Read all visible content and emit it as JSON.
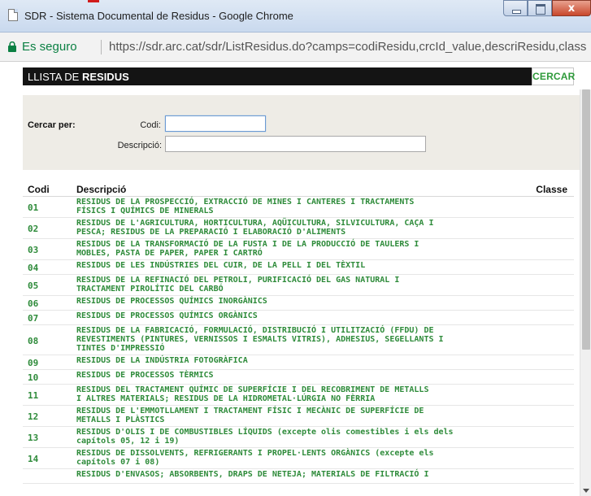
{
  "window": {
    "title": "SDR - Sistema Documental de Residus - Google Chrome"
  },
  "addressbar": {
    "secure_label": "Es seguro",
    "url": "https://sdr.arc.cat/sdr/ListResidus.do?camps=codiResidu,crcId_value,descriResidu,class"
  },
  "header": {
    "title_prefix": "LLISTA DE ",
    "title_bold": "RESIDUS",
    "search_button": "CERCAR"
  },
  "search": {
    "label": "Cercar per:",
    "codi_label": "Codi:",
    "codi_value": "",
    "descripcio_label": "Descripció:",
    "descripcio_value": ""
  },
  "table": {
    "headers": {
      "codi": "Codi",
      "descripcio": "Descripció",
      "classe": "Classe"
    },
    "rows": [
      {
        "codi": "01",
        "desc": [
          "RESIDUS DE LA PROSPECCIÓ, EXTRACCIÓ DE MINES I CANTERES I TRACTAMENTS",
          "FÍSICS I QUÍMICS DE MINERALS"
        ]
      },
      {
        "codi": "02",
        "desc": [
          "RESIDUS DE L'AGRICULTURA, HORTICULTURA, AQÜICULTURA, SILVICULTURA, CAÇA I",
          "PESCA; RESIDUS DE LA PREPARACIÓ I ELABORACIÓ D'ALIMENTS"
        ]
      },
      {
        "codi": "03",
        "desc": [
          "RESIDUS DE LA TRANSFORMACIÓ DE LA FUSTA I DE LA PRODUCCIÓ DE TAULERS I",
          "MOBLES, PASTA DE PAPER, PAPER I CARTRÓ"
        ]
      },
      {
        "codi": "04",
        "desc": [
          "RESIDUS DE LES INDÚSTRIES DEL CUIR, DE LA PELL I DEL TÈXTIL"
        ]
      },
      {
        "codi": "05",
        "desc": [
          "RESIDUS DE LA REFINACIÓ DEL PETROLI, PURIFICACIÓ DEL GAS NATURAL I",
          "TRACTAMENT PIROLÍTIC DEL CARBÓ"
        ]
      },
      {
        "codi": "06",
        "desc": [
          "RESIDUS DE PROCESSOS QUÍMICS INORGÀNICS"
        ]
      },
      {
        "codi": "07",
        "desc": [
          "RESIDUS DE PROCESSOS QUÍMICS ORGÀNICS"
        ]
      },
      {
        "codi": "08",
        "desc": [
          "RESIDUS DE LA FABRICACIÓ, FORMULACIÓ, DISTRIBUCIÓ I UTILITZACIÓ (FFDU) DE",
          "REVESTIMENTS (PINTURES, VERNISSOS I ESMALTS VITRIS), ADHESIUS, SEGELLANTS I",
          "TINTES D'IMPRESSIÓ"
        ]
      },
      {
        "codi": "09",
        "desc": [
          "RESIDUS DE LA INDÚSTRIA FOTOGRÀFICA"
        ]
      },
      {
        "codi": "10",
        "desc": [
          "RESIDUS DE PROCESSOS TÈRMICS"
        ]
      },
      {
        "codi": "11",
        "desc": [
          "RESIDUS DEL TRACTAMENT QUÍMIC DE SUPERFÍCIE I DEL RECOBRIMENT DE METALLS",
          "I ALTRES MATERIALS; RESIDUS DE LA HIDROMETAL·LÚRGIA NO FÈRRIA"
        ]
      },
      {
        "codi": "12",
        "desc": [
          "RESIDUS DE L'EMMOTLLAMENT I TRACTAMENT FÍSIC I MECÀNIC DE SUPERFÍCIE DE",
          "METALLS I PLÀSTICS"
        ]
      },
      {
        "codi": "13",
        "desc": [
          "RESIDUS D'OLIS I DE COMBUSTIBLES LÍQUIDS (excepte olis comestibles i els dels",
          "capítols 05, 12 i 19)"
        ]
      },
      {
        "codi": "14",
        "desc": [
          "RESIDUS DE DISSOLVENTS, REFRIGERANTS I PROPEL·LENTS ORGÀNICS (excepte els",
          "capítols 07 i 08)"
        ]
      },
      {
        "codi": "",
        "desc": [
          "RESIDUS D'ENVASOS; ABSORBENTS, DRAPS DE NETEJA; MATERIALS DE FILTRACIÓ I"
        ]
      }
    ]
  },
  "colors": {
    "link_green": "#2e8b3a",
    "header_black": "#141414",
    "panel_bg": "#eeece6",
    "secure_green": "#0b8043"
  },
  "icons": [
    "page-icon",
    "lock-icon",
    "minimize-icon",
    "maximize-icon",
    "close-icon",
    "scroll-down-icon"
  ]
}
